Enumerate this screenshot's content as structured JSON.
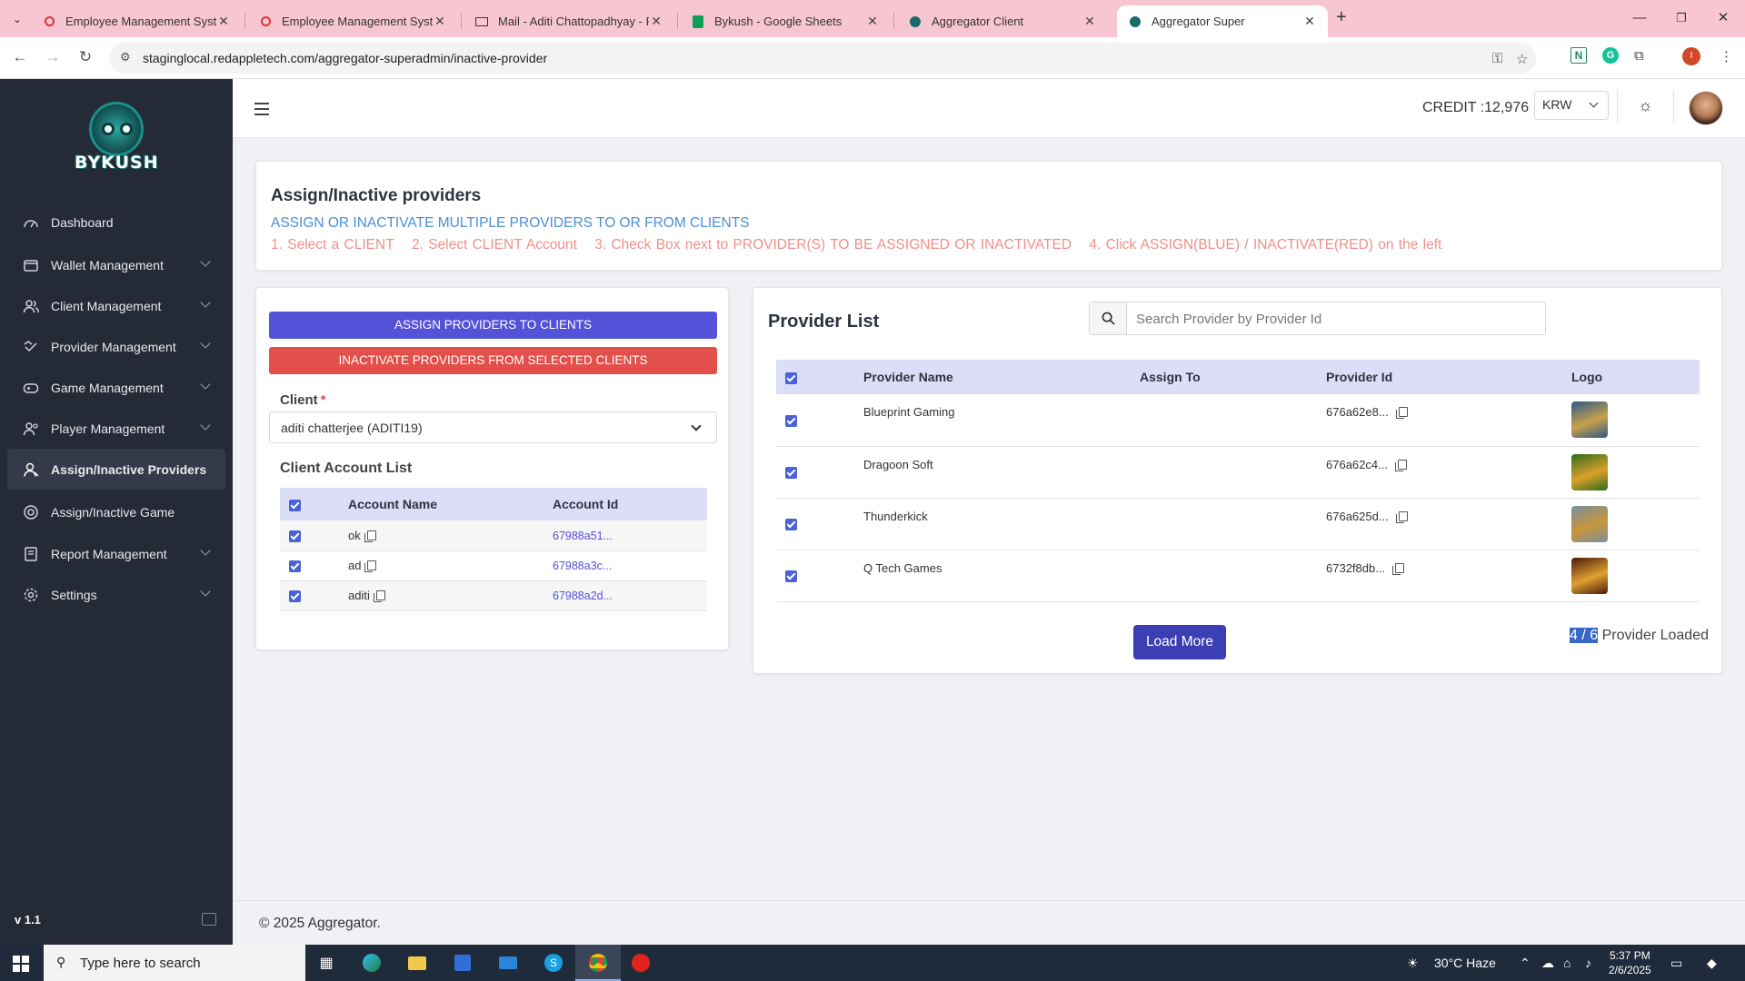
{
  "browser": {
    "tabs": [
      {
        "title": "Employee Management System",
        "icon": "red-logo-icon"
      },
      {
        "title": "Employee Management System",
        "icon": "red-logo-icon"
      },
      {
        "title": "Mail - Aditi Chattopadhyay - Pr",
        "icon": "mail-icon"
      },
      {
        "title": "Bykush - Google Sheets",
        "icon": "sheets-icon"
      },
      {
        "title": "Aggregator Client",
        "icon": "owl-icon"
      },
      {
        "title": "Aggregator Super",
        "icon": "owl-icon",
        "active": true
      }
    ],
    "url": "staginglocal.redappletech.com/aggregator-superadmin/inactive-provider",
    "profile_initial": "I"
  },
  "sidebar": {
    "logo_text": "BYKUSH",
    "items": [
      {
        "label": "Dashboard",
        "icon": "dashboard-icon",
        "has_submenu": false
      },
      {
        "label": "Wallet Management",
        "icon": "wallet-icon",
        "has_submenu": true
      },
      {
        "label": "Client Management",
        "icon": "users-icon",
        "has_submenu": true
      },
      {
        "label": "Provider Management",
        "icon": "provider-icon",
        "has_submenu": true
      },
      {
        "label": "Game Management",
        "icon": "gamepad-icon",
        "has_submenu": true
      },
      {
        "label": "Player Management",
        "icon": "player-icon",
        "has_submenu": true
      },
      {
        "label": "Assign/Inactive Providers",
        "icon": "user-icon",
        "has_submenu": false,
        "active": true
      },
      {
        "label": "Assign/Inactive Game",
        "icon": "game-circle-icon",
        "has_submenu": false
      },
      {
        "label": "Report Management",
        "icon": "report-icon",
        "has_submenu": true
      },
      {
        "label": "Settings",
        "icon": "settings-icon",
        "has_submenu": true
      }
    ],
    "version": "v 1.1"
  },
  "topbar": {
    "credit": "CREDIT :12,976",
    "currency": "KRW"
  },
  "header": {
    "title": "Assign/Inactive providers",
    "subtitle": "ASSIGN OR INACTIVATE MULTIPLE PROVIDERS TO OR FROM CLIENTS",
    "steps": [
      "1. Select a CLIENT",
      "2. Select CLIENT Account",
      "3. Check Box next to PROVIDER(S) TO BE ASSIGNED OR INACTIVATED",
      "4. Click ASSIGN(BLUE) / INACTIVATE(RED) on the left"
    ]
  },
  "left": {
    "assign_label": "ASSIGN PROVIDERS TO CLIENTS",
    "inactivate_label": "INACTIVATE PROVIDERS FROM SELECTED CLIENTS",
    "client_label": "Client",
    "client_required": "*",
    "client_value": "aditi chatterjee (ADITI19)",
    "account_list_title": "Client Account List",
    "columns": [
      "Account Name",
      "Account Id"
    ],
    "accounts": [
      {
        "name": "ok",
        "id": "67988a51..."
      },
      {
        "name": "ad",
        "id": "67988a3c..."
      },
      {
        "name": "aditi",
        "id": "67988a2d..."
      }
    ]
  },
  "right": {
    "title": "Provider List",
    "search_placeholder": "Search Provider by Provider Id",
    "columns": [
      "Provider Name",
      "Assign To",
      "Provider Id",
      "Logo"
    ],
    "providers": [
      {
        "name": "Blueprint Gaming",
        "assign_to": "",
        "id": "676a62e8...",
        "logo_colors": [
          "#2a5a8a",
          "#c9a04a"
        ]
      },
      {
        "name": "Dragoon Soft",
        "assign_to": "",
        "id": "676a62c4...",
        "logo_colors": [
          "#2e6b1e",
          "#d9a12a"
        ]
      },
      {
        "name": "Thunderkick",
        "assign_to": "",
        "id": "676a625d...",
        "logo_colors": [
          "#7a8fa0",
          "#c8963c"
        ]
      },
      {
        "name": "Q Tech Games",
        "assign_to": "",
        "id": "6732f8db...",
        "logo_colors": [
          "#4a1a08",
          "#e0a030"
        ]
      }
    ],
    "load_more": "Load More",
    "loaded_count": "4 / 6",
    "loaded_suffix": " Provider Loaded"
  },
  "footer": {
    "text": "© 2025 Aggregator."
  },
  "taskbar": {
    "search_placeholder": "Type here to search",
    "weather": "30°C  Haze",
    "time": "5:37 PM",
    "date": "2/6/2025"
  },
  "colors": {
    "sidebar": "#252a37",
    "assign": "#5452d8",
    "inactivate": "#e34f4a",
    "load_more": "#3c3fb4",
    "subtitle": "#4a8fd4",
    "steps": "#f08f8a"
  }
}
